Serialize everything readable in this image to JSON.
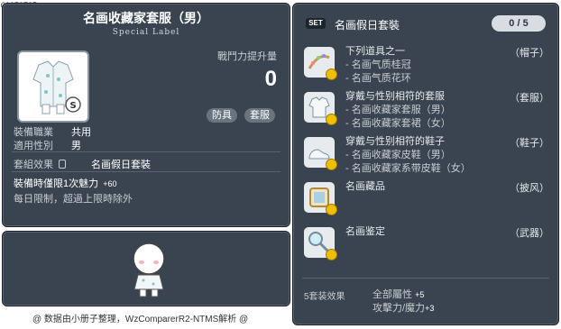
{
  "corner_id": "01050705",
  "item": {
    "title": "名画收藏家套服（男）",
    "subtitle": "Special Label",
    "power_label": "戰鬥力提升量",
    "power_value": "0",
    "tags": [
      "防具",
      "套服"
    ],
    "stats": [
      {
        "key": "裝備職業",
        "value": "共用"
      },
      {
        "key": "適用性別",
        "value": "男"
      }
    ],
    "set_effect_label": "套組效果",
    "set_name": "名画假日套裝",
    "limit_line1": "裝備時僅限1次魅力",
    "limit_value": "+60",
    "limit_line2": "每日限制，超過上限時除外"
  },
  "credit": "@ 数据由小册子整理，WzComparerR2-NTMS解析 @",
  "set": {
    "badge": "SET",
    "title": "名画假日套裝",
    "count": "0 / 5",
    "items": [
      {
        "icon": "hat-icon",
        "main": "下列道具之一",
        "subs": [
          "- 名画气质桂冠",
          "- 名画气质花环"
        ],
        "slot": "（帽子）"
      },
      {
        "icon": "overall-icon",
        "main": "穿戴与性别相符的套服",
        "subs": [
          "- 名画收藏家套服（男）",
          "- 名画收藏家套裙（女）"
        ],
        "slot": "（套服）"
      },
      {
        "icon": "shoes-icon",
        "main": "穿戴与性别相符的鞋子",
        "subs": [
          "- 名画收藏家皮鞋（男）",
          "- 名画收藏家系带皮鞋（女）"
        ],
        "slot": "（鞋子）"
      },
      {
        "icon": "cape-icon",
        "main": "名画藏品",
        "subs": [],
        "slot": "（披风）"
      },
      {
        "icon": "weapon-icon",
        "main": "名画鉴定",
        "subs": [],
        "slot": "（武器）"
      }
    ],
    "summary_label": "5套装效果",
    "summary": [
      {
        "text": "全部屬性",
        "value": "+5"
      },
      {
        "text": "攻擊力/魔力",
        "value": "+3"
      }
    ]
  }
}
